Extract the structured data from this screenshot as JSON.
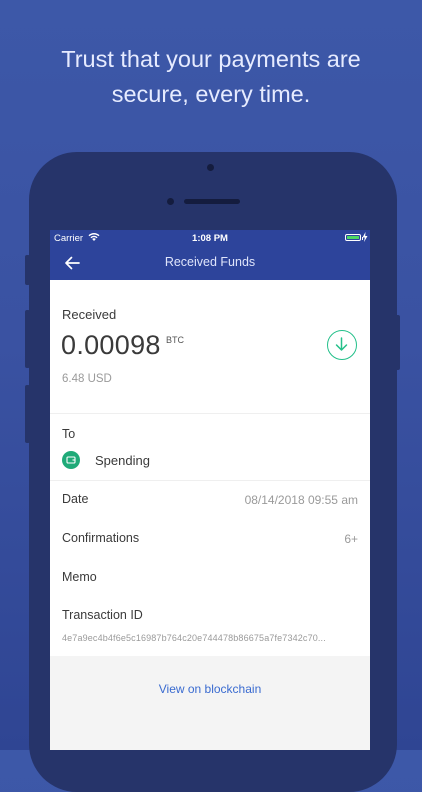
{
  "headline": {
    "line1": "Trust that your payments are",
    "line2": "secure, every time."
  },
  "status_bar": {
    "carrier": "Carrier",
    "time": "1:08 PM",
    "battery_level": 1.0
  },
  "nav": {
    "title": "Received Funds"
  },
  "transaction": {
    "direction_label": "Received",
    "amount": "0.00098",
    "currency": "BTC",
    "fiat_amount": "6.48 USD",
    "to_label": "To",
    "wallet_name": "Spending",
    "date_label": "Date",
    "date_value": "08/14/2018 09:55 am",
    "confirmations_label": "Confirmations",
    "confirmations_value": "6+",
    "memo_label": "Memo",
    "txid_label": "Transaction ID",
    "txid_value": "4e7a9ec4b4f6e5c16987b764c20e744478b86675a7fe7342c70..."
  },
  "footer": {
    "link_label": "View on blockchain"
  },
  "colors": {
    "background": "#3a52a2",
    "nav_bar": "#2d449b",
    "accent_green": "#24c08a",
    "link_blue": "#3a6bd0"
  }
}
